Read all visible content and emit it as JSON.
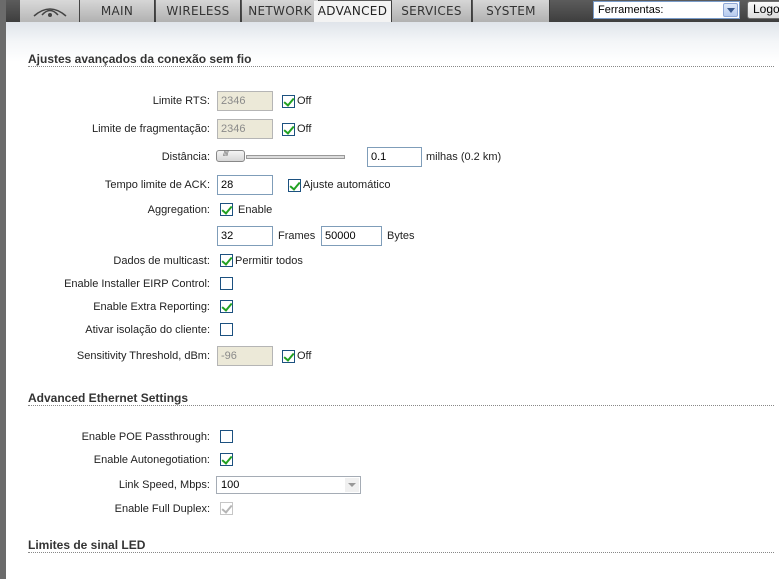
{
  "nav": {
    "tabs": [
      {
        "label": "MAIN"
      },
      {
        "label": "WIRELESS"
      },
      {
        "label": "NETWORK"
      },
      {
        "label": "ADVANCED",
        "active": true
      },
      {
        "label": "SERVICES"
      },
      {
        "label": "SYSTEM"
      }
    ],
    "tools_select": "Ferramentas:",
    "logout_label": "Logout"
  },
  "wireless_section": {
    "title": "Ajustes avançados da conexão sem fio",
    "rts": {
      "label": "Limite RTS:",
      "value": "2346",
      "off_checked": true,
      "off_label": "Off"
    },
    "frag": {
      "label": "Limite de fragmentação:",
      "value": "2346",
      "off_checked": true,
      "off_label": "Off"
    },
    "distance": {
      "label": "Distância:",
      "value": "0.1",
      "unit": "milhas (0.2 km)",
      "slider_fraction": 0.0
    },
    "ack": {
      "label": "Tempo limite de ACK:",
      "value": "28",
      "auto_checked": true,
      "auto_label": "Ajuste automático"
    },
    "aggregation": {
      "label": "Aggregation:",
      "enable_checked": true,
      "enable_label": "Enable",
      "frames_value": "32",
      "frames_label": "Frames",
      "bytes_value": "50000",
      "bytes_label": "Bytes"
    },
    "multicast": {
      "label": "Dados de multicast:",
      "checked": true,
      "option_label": "Permitir todos"
    },
    "installer_eirp": {
      "label": "Enable Installer EIRP Control:",
      "checked": false
    },
    "extra_reporting": {
      "label": "Enable Extra Reporting:",
      "checked": true
    },
    "client_isolation": {
      "label": "Ativar isolação do cliente:",
      "checked": false
    },
    "sensitivity": {
      "label": "Sensitivity Threshold, dBm:",
      "value": "-96",
      "off_checked": true,
      "off_label": "Off"
    }
  },
  "ethernet_section": {
    "title": "Advanced Ethernet Settings",
    "poe": {
      "label": "Enable POE Passthrough:",
      "checked": false
    },
    "autoneg": {
      "label": "Enable Autonegotiation:",
      "checked": true
    },
    "link_speed": {
      "label": "Link Speed, Mbps:",
      "value": "100"
    },
    "full_duplex": {
      "label": "Enable Full Duplex:",
      "checked": true,
      "disabled": true
    }
  },
  "led_section": {
    "title": "Limites de sinal LED"
  },
  "colors": {
    "topbar": "#4a4a4a",
    "tab": "#c4c4c4",
    "active_tab": "#f3f3f3",
    "checkmark": "#21a121",
    "input_border": "#7f9db9"
  }
}
